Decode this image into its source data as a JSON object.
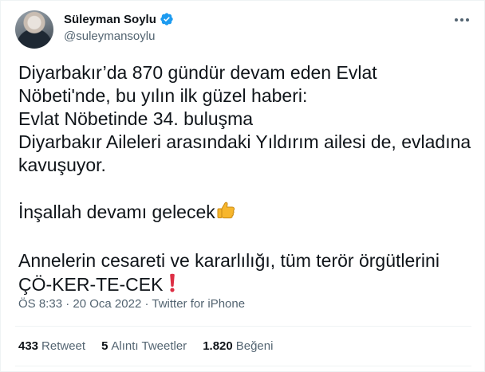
{
  "author": {
    "display_name": "Süleyman Soylu",
    "handle": "@suleymansoylu",
    "verified": true,
    "avatar_icon": "profile-photo",
    "verified_color": "#1d9bf0"
  },
  "tweet": {
    "lines": [
      "Diyarbakır’da 870 gündür devam eden Evlat",
      "Nöbeti'nde, bu yılın ilk güzel haberi:",
      "Evlat Nöbetinde 34. buluşma",
      "Diyarbakır Aileleri arasındaki Yıldırım ailesi de, evladına",
      "kavuşuyor."
    ],
    "line_inshallah": "İnşallah devamı gelecek",
    "thumbs_emoji": "thumbs-up",
    "line_mothers": "Annelerin cesareti ve kararlılığı, tüm terör örgütlerini",
    "line_collapse": "ÇÖ-KER-TE-CEK ",
    "exclamation_emoji": "red-exclamation"
  },
  "meta": {
    "time": "ÖS 8:33",
    "sep1": " · ",
    "date": "20 Oca 2022",
    "sep2": " · ",
    "source": "Twitter for iPhone"
  },
  "stats": {
    "retweets_count": "433",
    "retweets_label": "Retweet",
    "quotes_count": "5",
    "quotes_label": "Alıntı Tweetler",
    "likes_count": "1.820",
    "likes_label": "Beğeni"
  },
  "colors": {
    "text": "#0f1419",
    "secondary": "#536471",
    "border": "#eff3f4",
    "accent": "#1d9bf0"
  }
}
